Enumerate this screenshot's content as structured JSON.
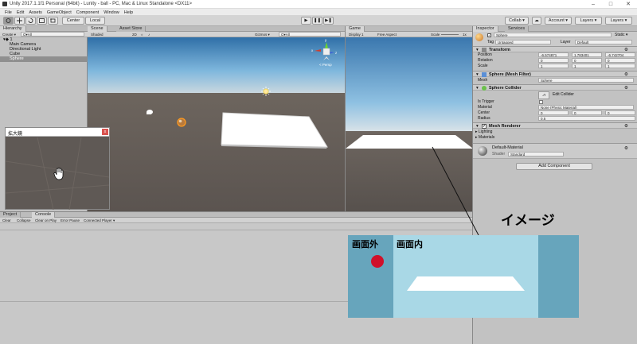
{
  "window": {
    "title": "Unity 2017.1.1f1 Personal (64bit) - Lunity - ball - PC, Mac & Linux Standalone <DX11>",
    "min": "–",
    "max": "□",
    "close": "✕"
  },
  "menu": [
    "File",
    "Edit",
    "Assets",
    "GameObject",
    "Component",
    "Window",
    "Help"
  ],
  "toolbar": {
    "center": "Center",
    "local": "Local",
    "collab": "Collab ▾",
    "account": "Account ▾",
    "layers": "Layers ▾",
    "layout": "Layers ▾",
    "play": "▶",
    "pause": "❚❚",
    "step": "▶❚",
    "cloud": "☁"
  },
  "hierarchy": {
    "tab": "Hierarchy",
    "create": "Create ▾",
    "search_placeholder": "Q▾All",
    "scene": "1",
    "items": [
      "Main Camera",
      "Directional Light",
      "Cube",
      "Sphere"
    ]
  },
  "scene": {
    "tab": "Scene",
    "asset_store_tab": "Asset Store",
    "shading": "Shaded",
    "mode_2d": "2D",
    "gizmos": "Gizmos ▾",
    "search": "Q▾All",
    "persp": "< Persp"
  },
  "game": {
    "tab": "Game",
    "display": "Display 1",
    "aspect": "Free Aspect",
    "scale_label": "Scale",
    "scale_value": "1x"
  },
  "magnifier": {
    "title": "拡大鏡",
    "close": "x"
  },
  "inspector": {
    "tab": "Inspector",
    "services_tab": "Services",
    "object_name": "Sphere",
    "static_label": "Static ▾",
    "tag_label": "Tag",
    "tag_value": "Untagged",
    "layer_label": "Layer",
    "layer_value": "Default",
    "transform": {
      "title": "Transform",
      "rows": [
        {
          "label": "Position",
          "x": "-6.574871",
          "y": "1.783401",
          "z": "-6.742704"
        },
        {
          "label": "Rotation",
          "x": "0",
          "y": "0",
          "z": "0"
        },
        {
          "label": "Scale",
          "x": "1",
          "y": "1",
          "z": "1"
        }
      ]
    },
    "mesh_filter": {
      "title": "Sphere (Mesh Filter)",
      "mesh_label": "Mesh",
      "mesh_value": "Sphere"
    },
    "collider": {
      "title": "Sphere Collider",
      "edit_label": "Edit Collider",
      "is_trigger_label": "Is Trigger",
      "material_label": "Material",
      "material_value": "None (Physic Material)",
      "center_label": "Center",
      "center": {
        "x": "0",
        "y": "0",
        "z": "0"
      },
      "radius_label": "Radius",
      "radius_value": "0.5"
    },
    "mesh_renderer": {
      "title": "Mesh Renderer",
      "lighting": "Lighting",
      "materials": "Materials"
    },
    "material": {
      "name": "Default-Material",
      "shader_label": "Shader",
      "shader_value": "Standard"
    },
    "add_component": "Add Component"
  },
  "project": {
    "tabs": [
      "Project",
      "Console"
    ],
    "buttons": [
      "Clear",
      "Collapse",
      "Clear on Play",
      "Error Pause",
      "Connected Player ▾"
    ]
  },
  "annotation": {
    "heading": "イメージ",
    "outside_label": "画面外",
    "inside_label": "画面内",
    "colors": {
      "outer": "#67a5bc",
      "inner": "#a9d8e6",
      "dot": "#d0102a",
      "plane": "#ffffff"
    }
  },
  "axis_letters": {
    "y": "y",
    "x": "x",
    "z": "z"
  }
}
